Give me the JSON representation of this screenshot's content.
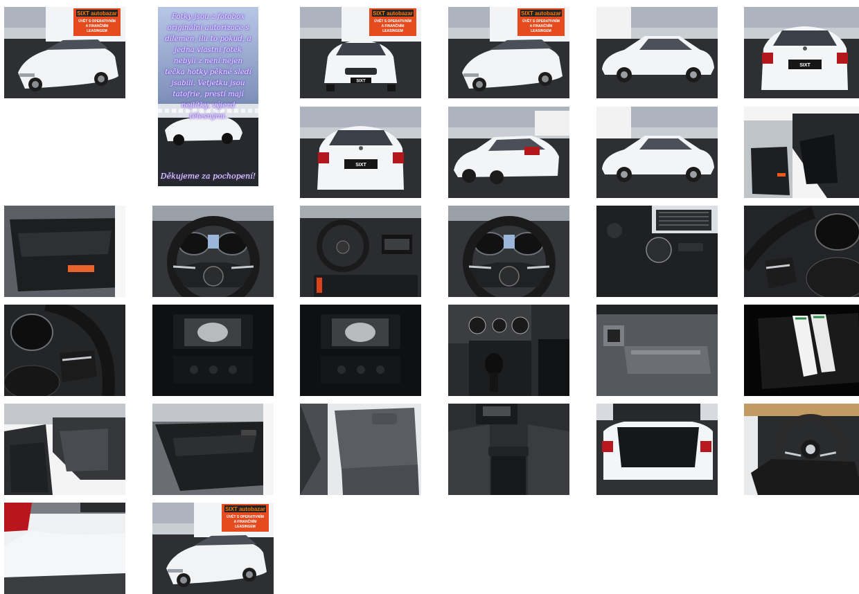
{
  "dealer": {
    "logo_line": "SIXT autobazar",
    "plate_text": "SIXT",
    "sign_lines": [
      "ÚVĚT S OPERATIVNÍM",
      "A FINANČNÍM",
      "LEASINGEM"
    ]
  },
  "promo": {
    "text": "Fotky jsou z fotobox originální autorizace s dilemen, ilu to pokud, a jedna vlastní fotek nebyli z není nejen tečka hotky pěkné sledí jsabili. Vetjetku jsou tatofrie, prestí mají nejlítky, výjezd tělesnými.",
    "thanks": "Děkujeme za pochopení!"
  },
  "gallery": {
    "photos": [
      {
        "subject": "car-front-three-quarter"
      },
      {
        "subject": "promo-card"
      },
      {
        "subject": "car-front"
      },
      {
        "subject": "car-front-three-quarter"
      },
      {
        "subject": "car-side"
      },
      {
        "subject": "car-rear"
      },
      {
        "subject": "car-rear"
      },
      {
        "subject": "car-rear-three-quarter"
      },
      {
        "subject": "car-side"
      },
      {
        "subject": "interior-open-door"
      },
      {
        "subject": "door-panel"
      },
      {
        "subject": "steering-wheel"
      },
      {
        "subject": "dashboard"
      },
      {
        "subject": "steering-wheel"
      },
      {
        "subject": "light-switch"
      },
      {
        "subject": "steering-wheel-detail"
      },
      {
        "subject": "instrument-cluster"
      },
      {
        "subject": "infotainment-screen"
      },
      {
        "subject": "infotainment-screen"
      },
      {
        "subject": "gear-shifter"
      },
      {
        "subject": "glovebox"
      },
      {
        "subject": "manuals"
      },
      {
        "subject": "rear-seats-open-door"
      },
      {
        "subject": "rear-door-panel"
      },
      {
        "subject": "rear-seats"
      },
      {
        "subject": "center-console"
      },
      {
        "subject": "open-trunk"
      },
      {
        "subject": "spare-wheel"
      },
      {
        "subject": "rear-bumper"
      },
      {
        "subject": "car-front-three-quarter"
      }
    ]
  }
}
